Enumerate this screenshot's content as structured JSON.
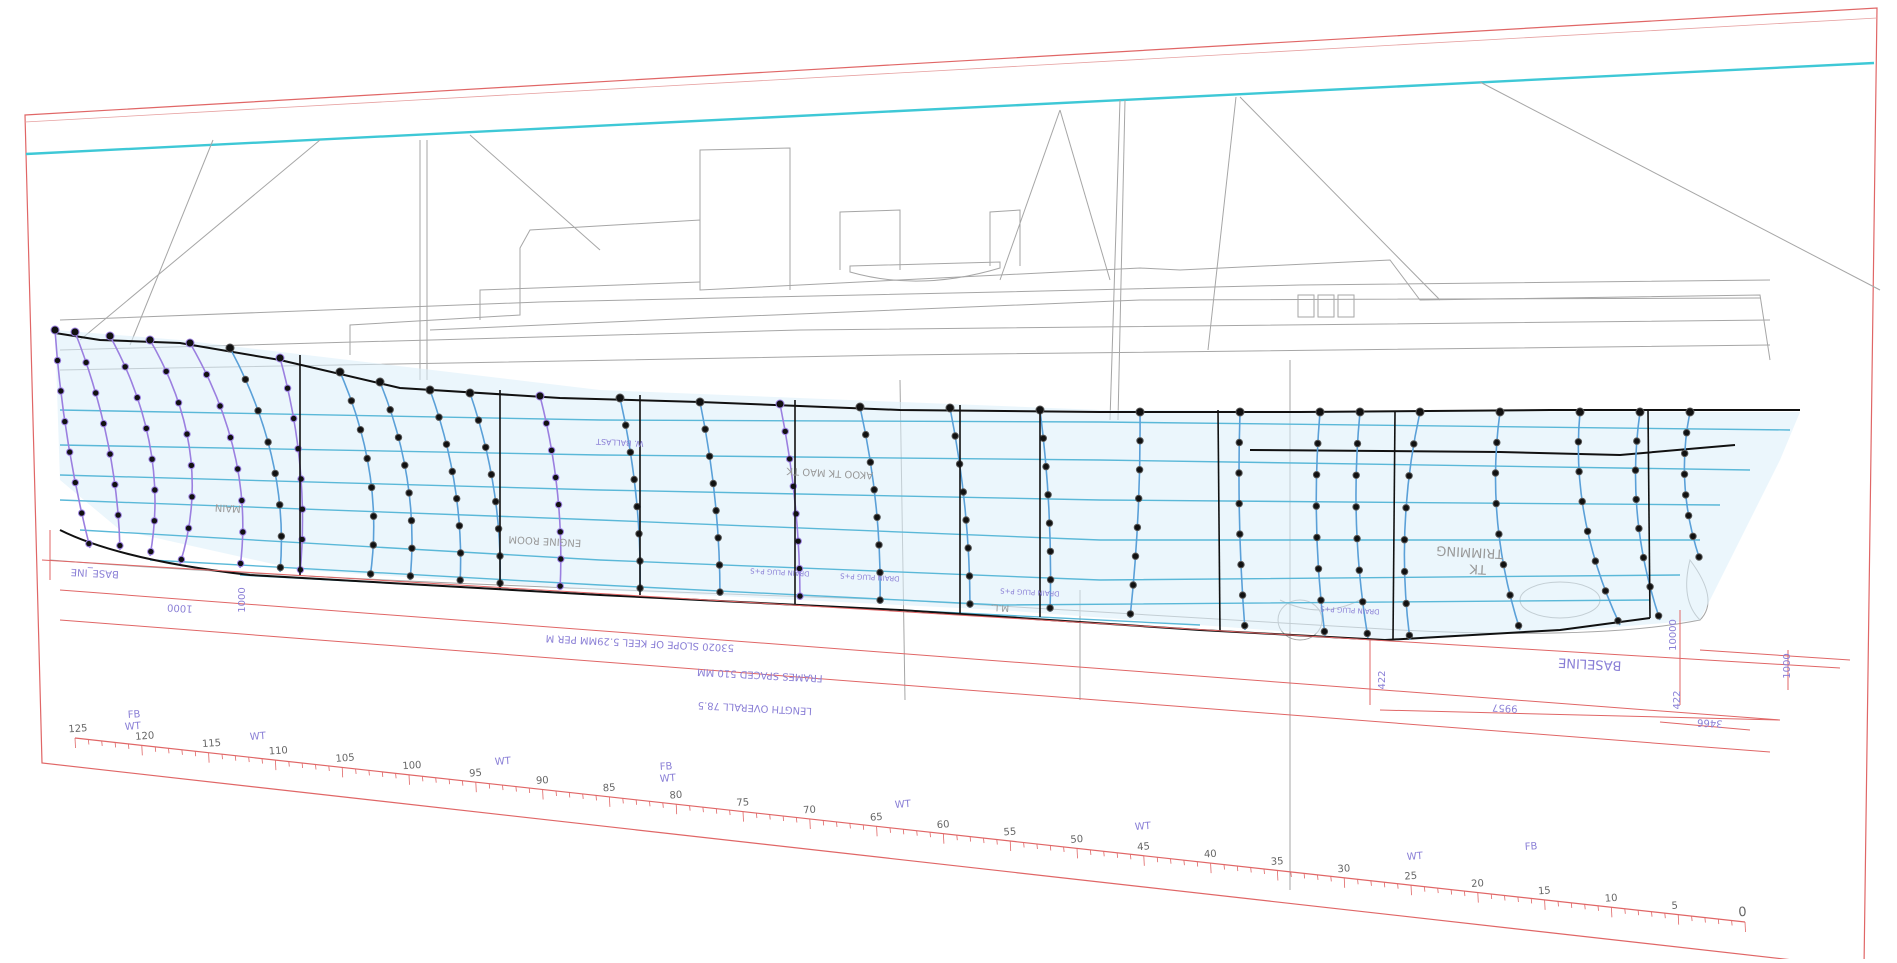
{
  "drawing": {
    "dimension_labels": {
      "slope_of_keel": "53020   SLOPE OF KEEL 5.29MM PER M",
      "frame_spacing": "FRAMES SPACED 510 MM",
      "length_overall": "LENGTH OVERALL 78.5",
      "baseline": "BASELINE",
      "baseline_left": "BASE_INE",
      "dim_1": "9957",
      "dim_2": "3466",
      "dim_3": "1000",
      "dim_4": "1000",
      "dim_5": "422",
      "dim_6": "422",
      "dim_7": "1000",
      "dim_8": "10000"
    },
    "ruler": {
      "labels": [
        "125",
        "120",
        "115",
        "110",
        "105",
        "100",
        "95",
        "90",
        "85",
        "80",
        "75",
        "70",
        "65",
        "60",
        "55",
        "50",
        "45",
        "40",
        "35",
        "30",
        "25",
        "20",
        "15",
        "10",
        "5",
        "0"
      ],
      "markers": {
        "fb_left": "FB",
        "wt_left": "WT",
        "wt_2": "WT",
        "wt_3": "WT",
        "fb_mid": "FB",
        "wt_mid": "WT",
        "wt_4": "WT",
        "wt_5": "WT",
        "wt_6": "WT",
        "fb_right": "FB"
      }
    },
    "compartments": {
      "trimming_tank": "TRIMMING",
      "trimming_tank_2": "TK",
      "engine_room": "ENGINE ROOM",
      "engine_room_2": "MAIN",
      "water_ballast": "W. BALLAST",
      "aux_text_1": "AKOO TK MAO TK",
      "drain_plug_1": "DRAIN PLUG P+S",
      "drain_plug_2": "DRAIN PLUG P+S",
      "drain_plug_3": "DRAIN PLUG P+S",
      "drain_plug_4": "DRAIN PLUG P+S",
      "ml": "M.L."
    },
    "colors": {
      "frame_outline": "#e06666",
      "hull_curve": "#5aa0d8",
      "hull_fill": "#dbeefa",
      "waterline": "#3ec8d6",
      "highlight_curve": "#9b7fe0",
      "control_point": "#111111",
      "ruler": "#e06666",
      "reference_drawing": "#999999",
      "annotation_text": "#8a7fd6"
    }
  }
}
